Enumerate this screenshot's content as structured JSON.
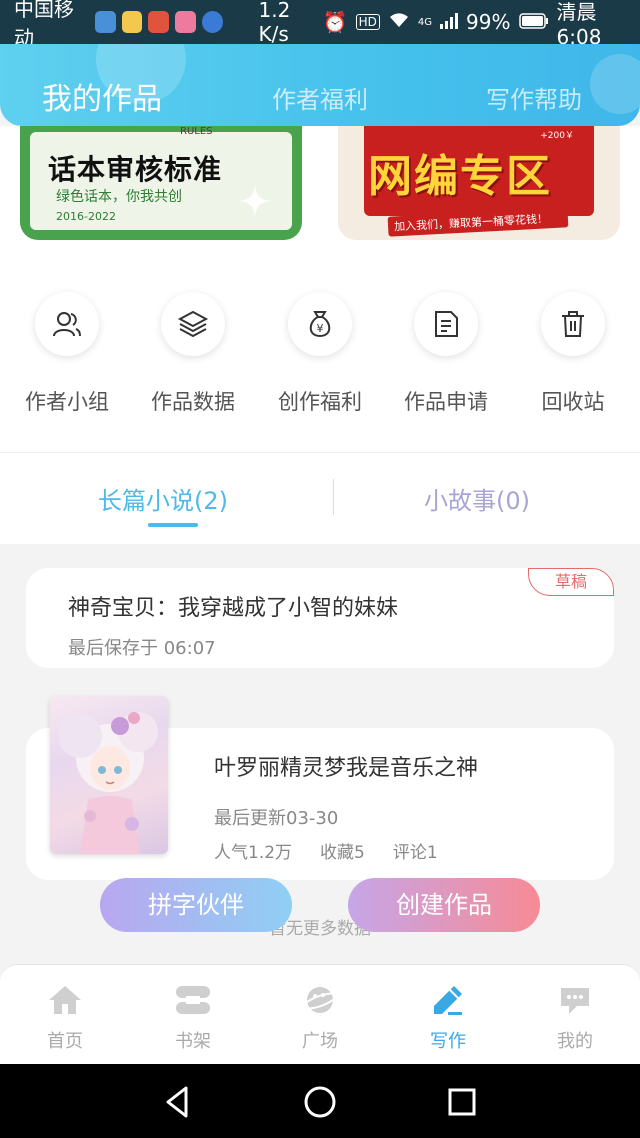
{
  "status_bar": {
    "carrier": "中国移动",
    "speed": "1.2 K/s",
    "hd": "HD",
    "net": "4G",
    "battery": "99%",
    "time": "清晨6:08"
  },
  "header": {
    "tabs": [
      {
        "label": "我的作品",
        "active": true
      },
      {
        "label": "作者福利",
        "active": false
      },
      {
        "label": "写作帮助",
        "active": false
      }
    ]
  },
  "banners": {
    "left": {
      "title": "话本审核标准",
      "sub": "绿色话本，你我共创",
      "year": "2016-2022",
      "tag": "RULES"
    },
    "right": {
      "title": "网编专区",
      "sub": "加入我们，赚取第一桶零花钱！",
      "amount": "+200￥"
    }
  },
  "quick_actions": [
    {
      "label": "作者小组",
      "icon": "users-icon"
    },
    {
      "label": "作品数据",
      "icon": "layers-icon"
    },
    {
      "label": "创作福利",
      "icon": "money-bag-icon"
    },
    {
      "label": "作品申请",
      "icon": "document-icon"
    },
    {
      "label": "回收站",
      "icon": "trash-icon"
    }
  ],
  "segment_tabs": [
    {
      "label": "长篇小说(2)",
      "active": true
    },
    {
      "label": "小故事(0)",
      "active": false
    }
  ],
  "works": [
    {
      "title": "神奇宝贝：我穿越成了小智的妹妹",
      "meta": "最后保存于 06:07",
      "badge": "草稿"
    },
    {
      "title": "叶罗丽精灵梦我是音乐之神",
      "meta": "最后更新03-30",
      "popularity": "人气1.2万",
      "favorites": "收藏5",
      "comments": "评论1"
    }
  ],
  "no_more": "暂无更多数据",
  "fabs": {
    "partner": "拼字伙伴",
    "create": "创建作品"
  },
  "bottom_nav": [
    {
      "label": "首页",
      "icon": "home-icon",
      "active": false
    },
    {
      "label": "书架",
      "icon": "bookshelf-icon",
      "active": false
    },
    {
      "label": "广场",
      "icon": "planet-icon",
      "active": false
    },
    {
      "label": "写作",
      "icon": "pen-icon",
      "active": true
    },
    {
      "label": "我的",
      "icon": "chat-bubble-icon",
      "active": false
    }
  ],
  "colors": {
    "accent": "#4db9e8",
    "header": "#45c1ec",
    "draft": "#e56b6b",
    "nav_active": "#3ba8e6"
  }
}
